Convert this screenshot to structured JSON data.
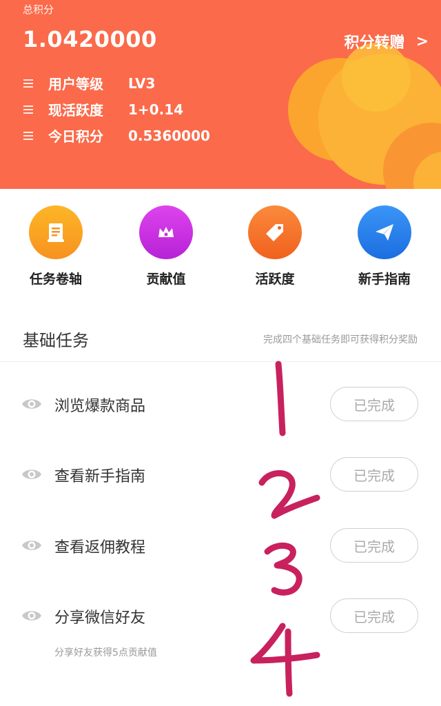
{
  "header": {
    "total_label": "总积分",
    "total_value": "1.0420000",
    "transfer_label": "积分转赠",
    "transfer_arrow": ">",
    "stats": [
      {
        "label": "用户等级",
        "value": "LV3"
      },
      {
        "label": "现活跃度",
        "value": "1+0.14"
      },
      {
        "label": "今日积分",
        "value": "0.5360000"
      }
    ],
    "colors": {
      "background": "#fb6a4a",
      "circles": "#fbb236"
    }
  },
  "shortcuts": [
    {
      "label": "任务卷轴",
      "icon": "scroll-icon",
      "color": "#f9a424"
    },
    {
      "label": "贡献值",
      "icon": "crown-icon",
      "color": "#c932e0"
    },
    {
      "label": "活跃度",
      "icon": "tag-icon",
      "color": "#f5722a"
    },
    {
      "label": "新手指南",
      "icon": "paper-plane-icon",
      "color": "#2a82ec"
    }
  ],
  "section": {
    "title": "基础任务",
    "hint": "完成四个基础任务即可获得积分奖励"
  },
  "tasks": [
    {
      "name": "浏览爆款商品",
      "button": "已完成",
      "icon": "eye-icon"
    },
    {
      "name": "查看新手指南",
      "button": "已完成",
      "icon": "eye-icon"
    },
    {
      "name": "查看返佣教程",
      "button": "已完成",
      "icon": "eye-icon"
    },
    {
      "name": "分享微信好友",
      "button": "已完成",
      "icon": "eye-icon",
      "note": "分享好友获得5点贡献值"
    }
  ],
  "annotations": {
    "handwritten_numbers": [
      "1",
      "2",
      "3",
      "4"
    ],
    "color": "#c8215e"
  }
}
